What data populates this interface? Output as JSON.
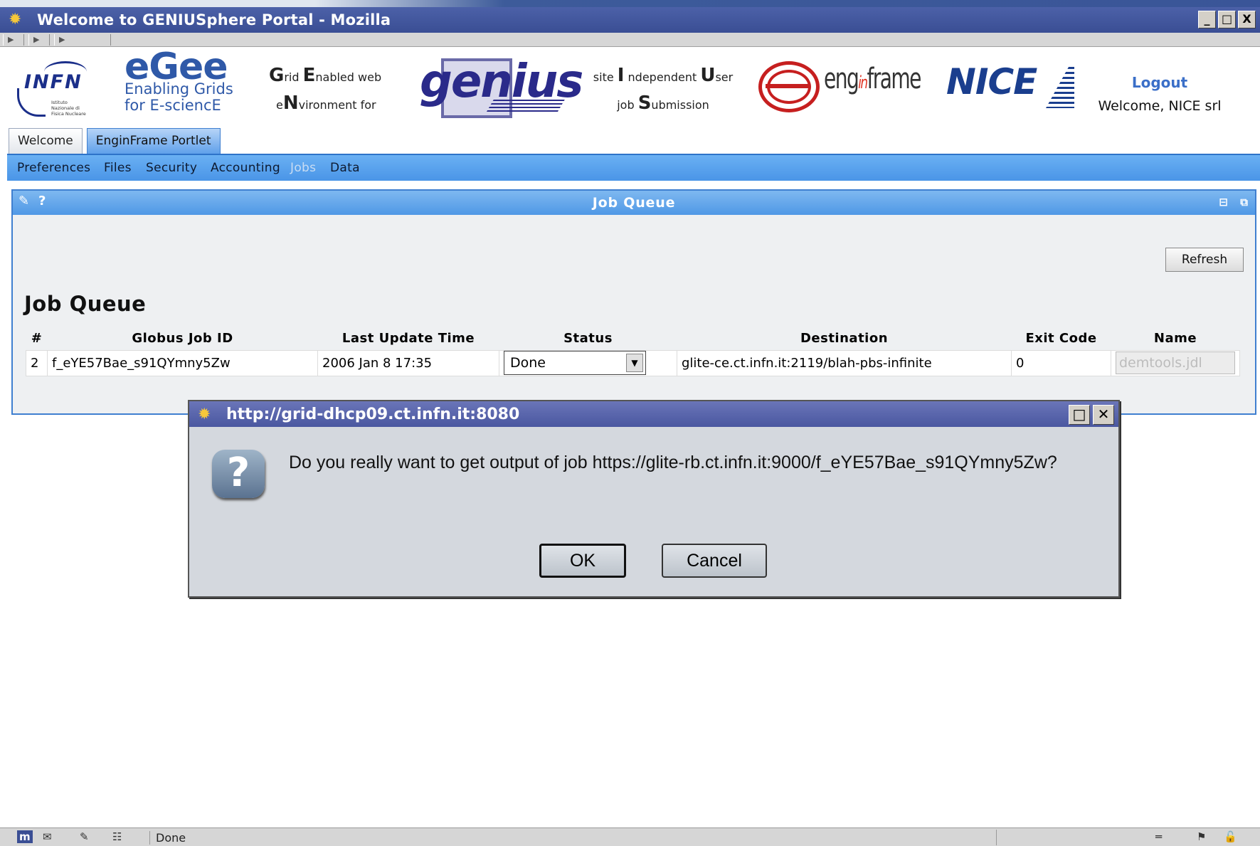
{
  "window": {
    "title": "Welcome to GENIUSphere Portal - Mozilla",
    "buttons": [
      "_",
      "□",
      "X"
    ]
  },
  "header": {
    "infn_logo": "INFN",
    "infn_subtext": "Istituto Nazionale di Fisica Nucleare",
    "egee_logo": "eGee",
    "egee_tagline_1": "Enabling Grids",
    "egee_tagline_2": "for E-sciencE",
    "grid_text_1": "rid ",
    "grid_text_1b": "nabled web",
    "grid_text_2a": "e",
    "grid_text_2b": "vironment for",
    "genius_logo": "genius",
    "site_text_1a": "site ",
    "site_text_1b": " ndependent ",
    "site_text_1c": "ser",
    "site_text_2a": "job ",
    "site_text_2b": "ubmission",
    "enginframe_logo_a": "eng",
    "enginframe_logo_b": "in",
    "enginframe_logo_c": "frame",
    "nice_logo": "NICE",
    "logout": "Logout",
    "welcome": "Welcome, NICE srl"
  },
  "tabs": [
    {
      "label": "Welcome",
      "active": false
    },
    {
      "label": "EnginFrame Portlet",
      "active": true
    }
  ],
  "menu": [
    {
      "label": "Preferences",
      "active": false
    },
    {
      "label": "Files",
      "active": false
    },
    {
      "label": "Security",
      "active": false
    },
    {
      "label": "Accounting",
      "active": false
    },
    {
      "label": "Jobs",
      "active": true
    },
    {
      "label": "Data",
      "active": false
    }
  ],
  "portlet": {
    "title": "Job Queue",
    "edit_icon": "pencil-icon",
    "help_icon": "?",
    "refresh_label": "Refresh",
    "heading": "Job Queue"
  },
  "table": {
    "columns": [
      "#",
      "Globus Job ID",
      "Last Update Time",
      "Status",
      "Destination",
      "Exit Code",
      "Name"
    ],
    "rows": [
      {
        "num": "2",
        "job_id": "f_eYE57Bae_s91QYmny5Zw",
        "updated": "2006 Jan 8 17:35",
        "status": "Done",
        "destination": "glite-ce.ct.infn.it:2119/blah-pbs-infinite",
        "exit_code": "0",
        "name": "demtools.jdl"
      }
    ]
  },
  "dialog": {
    "title": "http://grid-dhcp09.ct.infn.it:8080",
    "message": "Do you really want to get output of job https://glite-rb.ct.infn.it:9000/f_eYE57Bae_s91QYmny5Zw?",
    "ok": "OK",
    "cancel": "Cancel"
  },
  "statusbar": {
    "status": "Done"
  },
  "colors": {
    "titlebar": "#3f54a0",
    "tab_active": "#5fa0ea",
    "menubar": "#4a95e7",
    "portlet_border": "#3f7fd0",
    "logout": "#3b6fc8"
  }
}
